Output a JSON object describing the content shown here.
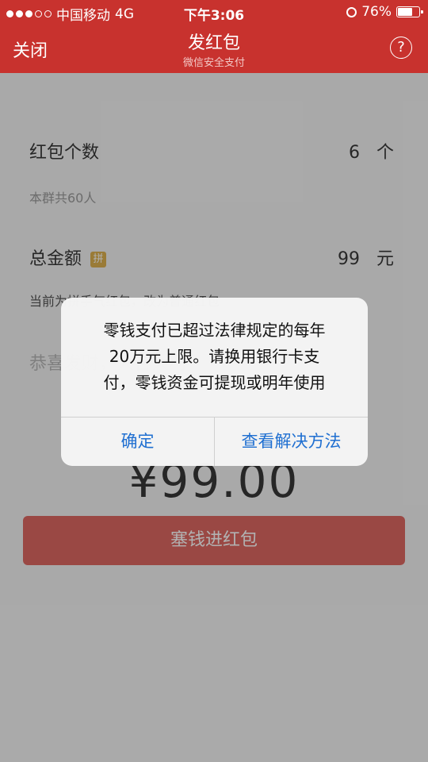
{
  "status_bar": {
    "carrier": "中国移动",
    "network": "4G",
    "time": "下午3:06",
    "battery": "76%",
    "battery_level": 0.76
  },
  "nav": {
    "close_label": "关闭",
    "title": "发红包",
    "subtitle": "微信安全支付",
    "help_label": "?"
  },
  "form": {
    "count_label": "红包个数",
    "count_value": "6",
    "count_unit": "个",
    "group_note": "本群共60人",
    "total_label": "总金额",
    "pin_badge": "拼",
    "total_value": "99",
    "total_unit": "元",
    "type_note": "当前为拼手气红包，改为普通红包",
    "greeting_placeholder": "恭喜发财，大吉大利",
    "big_amount": "¥99.00",
    "submit_label": "塞钱进红包"
  },
  "alert": {
    "message_lines": [
      "零钱支付已超过法律规定的每年",
      "20万元上限。请换用银行卡支",
      "付，零钱资金可提现或明年使用"
    ],
    "confirm_label": "确定",
    "solution_label": "查看解决方法"
  },
  "colors": {
    "brand_red": "#c8322e",
    "link_blue": "#1f6fd1"
  }
}
